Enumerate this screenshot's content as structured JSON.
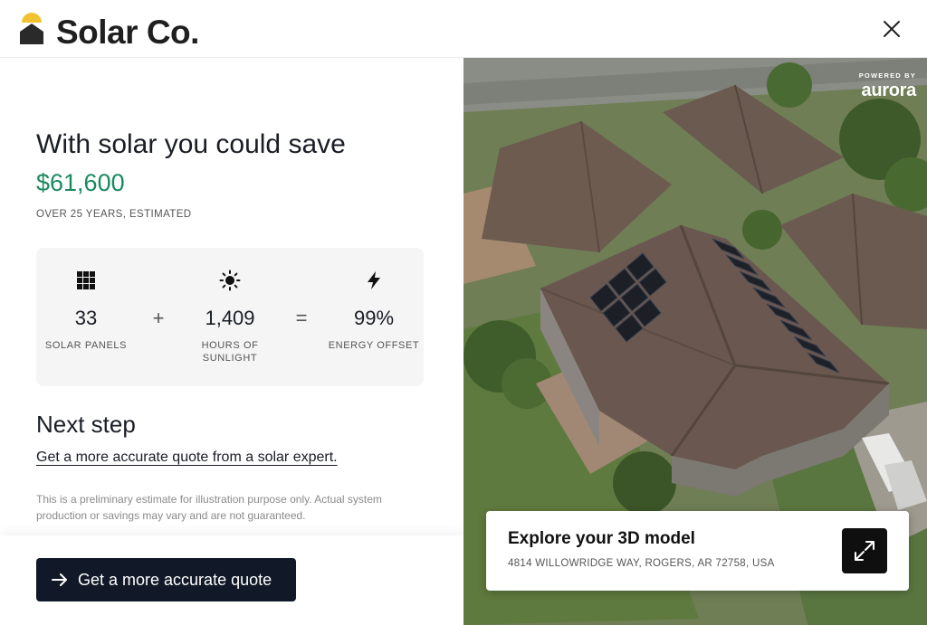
{
  "header": {
    "brand": "Solar Co.",
    "logo_icon": "house-sun-logo-icon",
    "close_icon": "close-icon"
  },
  "savings": {
    "headline": "With solar you could save",
    "amount": "$61,600",
    "note": "OVER 25 YEARS, ESTIMATED"
  },
  "stats": {
    "panels": {
      "value": "33",
      "label": "SOLAR PANELS",
      "icon": "solar-panel-grid-icon"
    },
    "sunlight": {
      "value": "1,409",
      "label": "HOURS OF SUNLIGHT",
      "icon": "sun-icon"
    },
    "offset": {
      "value": "99%",
      "label": "ENERGY OFFSET",
      "icon": "lightning-bolt-icon"
    },
    "plus": "+",
    "equals": "="
  },
  "next_step": {
    "title": "Next step",
    "link": "Get a more accurate quote from a solar expert.",
    "disclaimer": "This is a preliminary estimate for illustration purpose only. Actual system production or savings may vary and are not guaranteed."
  },
  "footer": {
    "cta_label": "Get a more accurate quote",
    "cta_icon": "arrow-right-icon"
  },
  "model": {
    "powered_by": "POWERED BY",
    "powered_brand": "aurora",
    "explore_title": "Explore your 3D model",
    "address": "4814 WILLOWRIDGE WAY, ROGERS, AR 72758, USA",
    "expand_icon": "expand-arrows-icon"
  },
  "colors": {
    "accent_green": "#1a8a5e",
    "dark": "#111827",
    "panel_bg": "#f5f5f5"
  }
}
